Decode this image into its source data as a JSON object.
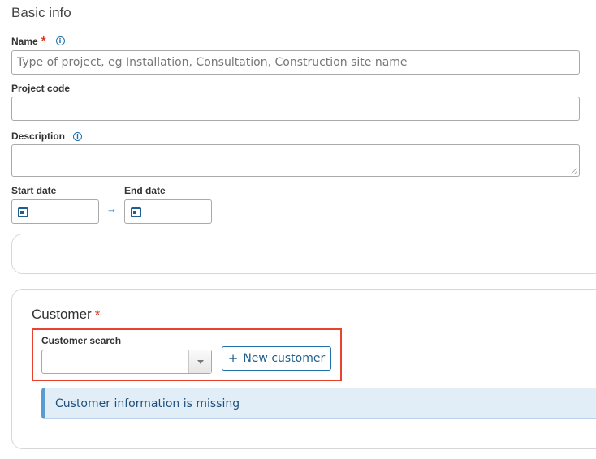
{
  "section": {
    "title": "Basic info"
  },
  "name": {
    "label": "Name",
    "required_mark": "*",
    "info_icon": "info-icon",
    "placeholder": "Type of project, eg Installation, Consultation, Construction site name",
    "value": ""
  },
  "project_code": {
    "label": "Project code",
    "value": ""
  },
  "description": {
    "label": "Description",
    "info_icon": "info-icon",
    "value": ""
  },
  "dates": {
    "start_label": "Start date",
    "end_label": "End date",
    "separator_icon": "arrow-right-icon",
    "calendar_icon": "calendar-icon",
    "arrow_glyph": "→"
  },
  "customer": {
    "title": "Customer",
    "required_mark": "*",
    "search_label": "Customer search",
    "search_value": "",
    "new_button_icon": "+",
    "new_button_label": "New customer",
    "missing_message": "Customer information is missing"
  },
  "colors": {
    "accent": "#1f6fa8",
    "required": "#d93a2b",
    "highlight": "#e8432e",
    "alert_bg": "#e1edf7"
  }
}
